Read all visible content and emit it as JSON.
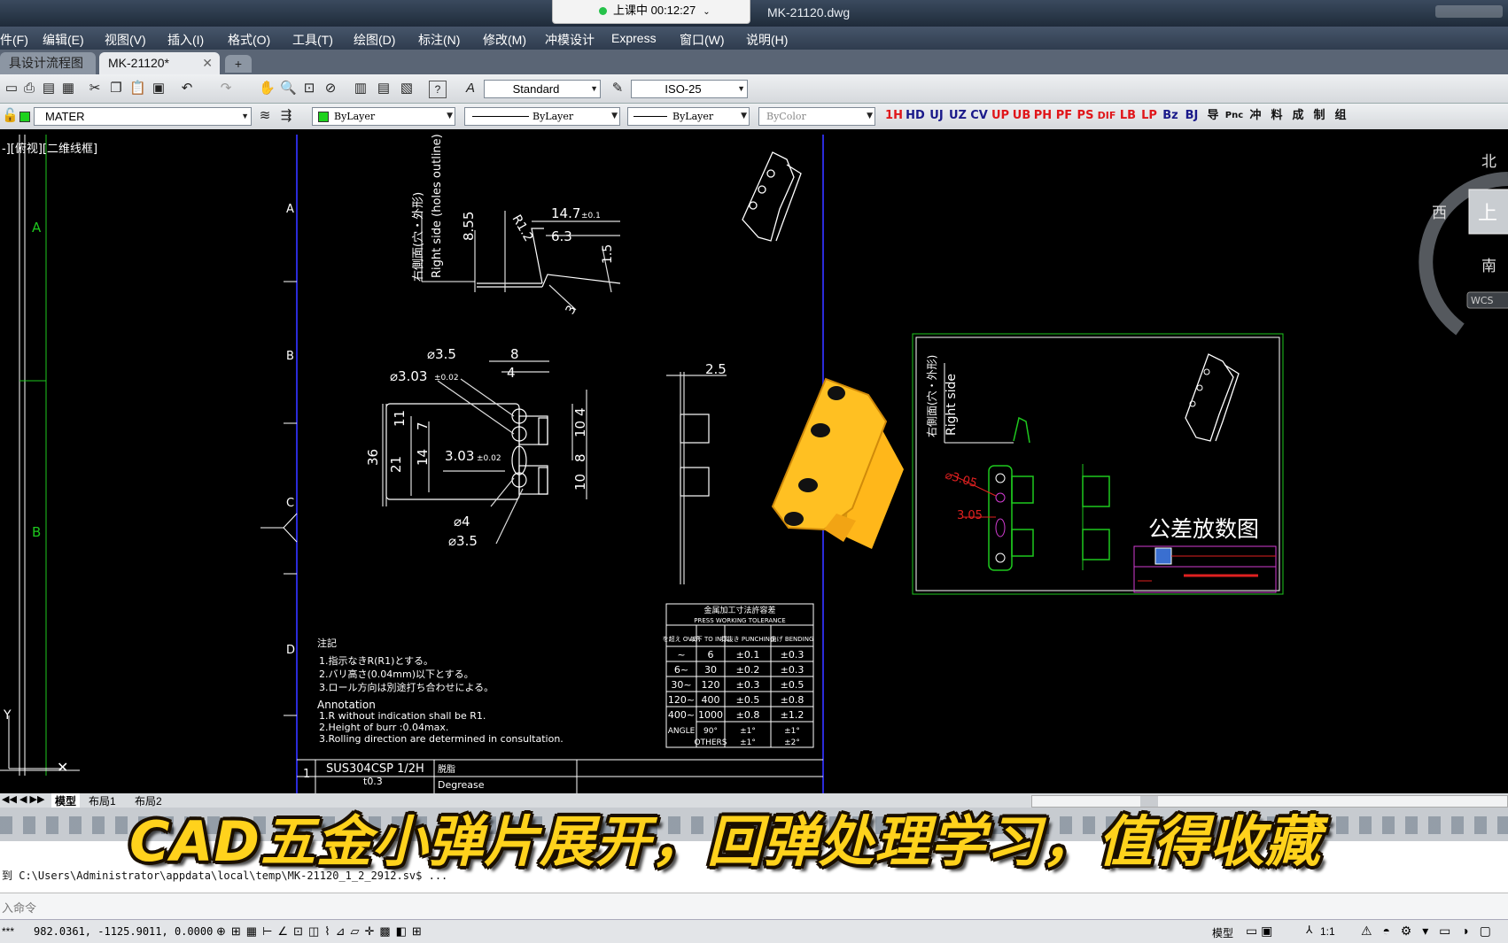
{
  "window": {
    "title": "MK-21120.dwg",
    "class_status": "上课中 00:12:27"
  },
  "menu": [
    "件(F)",
    "编辑(E)",
    "视图(V)",
    "插入(I)",
    "格式(O)",
    "工具(T)",
    "绘图(D)",
    "标注(N)",
    "修改(M)",
    "冲模设计",
    "Express",
    "窗口(W)",
    "说明(H)"
  ],
  "tabs": [
    {
      "label": "具设计流程图*",
      "active": false
    },
    {
      "label": "MK-21120*",
      "active": true
    }
  ],
  "toolbar1": {
    "text_style": "Standard",
    "dim_style": "ISO-25"
  },
  "toolbar2": {
    "layer": "MATER",
    "color": "ByLayer",
    "linetype": "ByLayer",
    "lineweight": "ByLayer",
    "plotstyle": "ByColor",
    "custom_buttons": [
      "1H",
      "HD",
      "UJ",
      "UZ",
      "CV",
      "UP",
      "UB",
      "PH",
      "PF",
      "PS",
      "DIF",
      "LB",
      "LP",
      "Bz",
      "BJ",
      "导",
      "Pnc",
      "冲",
      "料",
      "成",
      "制",
      "组"
    ]
  },
  "viewport_label": "-][俯视][二维线框]",
  "viewcube": {
    "north": "北",
    "south": "南",
    "west": "西",
    "face": "上",
    "ucs": "WCS"
  },
  "drawing": {
    "row_labels_left": [
      "A",
      "B"
    ],
    "row_labels_frame": [
      "A",
      "B",
      "C",
      "D"
    ],
    "side_label": "Right side (holes outline)",
    "side_label_jp": "右側面(穴・外形)",
    "dims_top": [
      "R1.2",
      "14.7",
      "±0.1",
      "6.3",
      "8.55",
      "1.5",
      "3"
    ],
    "dims_front": [
      "⌀3.5",
      "8",
      "⌀3.03",
      "±0.02",
      "4",
      "3.03",
      "±0.02",
      "11",
      "7",
      "36",
      "21",
      "14",
      "4",
      "10",
      "8",
      "10",
      "⌀4",
      "⌀3.5"
    ],
    "dim_side": "2.5",
    "notes_title": "注記",
    "notes_jp": [
      "1.指示なきR(R1)とする。",
      "2.バリ高さ(0.04mm)以下とする。",
      "3.ロール方向は別途打ち合わせによる。"
    ],
    "notes_en_title": "Annotation",
    "notes_en": [
      "1.R without indication shall be R1.",
      "2.Height of burr :0.04max.",
      "3.Rolling direction are determined in consultation."
    ],
    "tolerance_table": {
      "title": "金属加工寸法許容差",
      "subtitle": "PRESS WORKING TOLERANCE",
      "headers": [
        "を超え OVER",
        "以下 TO INCL.",
        "打抜き PUNCHING",
        "曲げ BENDING"
      ],
      "rows": [
        [
          "~",
          "6",
          "±0.1",
          "±0.3"
        ],
        [
          "6~",
          "30",
          "±0.2",
          "±0.3"
        ],
        [
          "30~",
          "120",
          "±0.3",
          "±0.5"
        ],
        [
          "120~",
          "400",
          "±0.5",
          "±0.8"
        ],
        [
          "400~",
          "1000",
          "±0.8",
          "±1.2"
        ],
        [
          "ANGLE",
          "90°",
          "±1°",
          "±1°"
        ],
        [
          "",
          "OTHERS",
          "±1°",
          "±2°"
        ]
      ]
    },
    "title_block": {
      "row": "1",
      "material": "SUS304CSP 1/2H",
      "thickness": "t0.3",
      "note_jp": "脱脂",
      "note_en": "Degrease"
    },
    "inset": {
      "side_label": "Right side",
      "side_label_jp": "右側面(穴・外形)",
      "dim1": "⌀3.05",
      "dim2": "3.05",
      "caption": "公差放数图"
    }
  },
  "layout_tabs": [
    "模型",
    "布局1",
    "布局2"
  ],
  "subtitle": "CAD五金小弹片展开，回弹处理学习，值得收藏",
  "command_line": "到 C:\\Users\\Administrator\\appdata\\local\\temp\\MK-21120_1_2_2912.sv$ ...",
  "command_prompt": "入命令",
  "status": {
    "coords": "982.0361, -1125.9011, 0.0000",
    "prefix": "***",
    "model": "模型",
    "scale": "1:1"
  }
}
